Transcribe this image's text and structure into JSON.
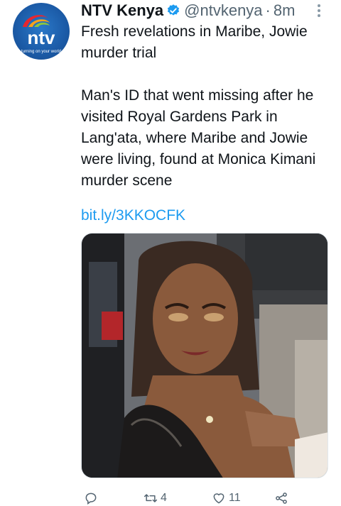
{
  "tweet": {
    "author_name": "NTV Kenya",
    "handle": "@ntvkenya",
    "separator": "·",
    "time": "8m",
    "text_line1": "Fresh revelations in Maribe, Jowie murder trial",
    "text_line2": "Man's ID that went missing after he visited Royal Gardens Park in Lang'ata, where Maribe and Jowie were living, found at Monica Kimani murder scene",
    "link": "bit.ly/3KKOCFK"
  },
  "avatar": {
    "logo_text": "ntv",
    "tagline": "turning on your world"
  },
  "actions": {
    "reply_count": "",
    "retweet_count": "4",
    "like_count": "11"
  },
  "colors": {
    "link": "#1d9bf0",
    "secondary_text": "#536471",
    "verified": "#1d9bf0",
    "avatar_blue": "#1b5aa6"
  },
  "icons": [
    "verified-badge-icon",
    "more-options-icon",
    "reply-icon",
    "retweet-icon",
    "like-icon",
    "share-icon"
  ]
}
